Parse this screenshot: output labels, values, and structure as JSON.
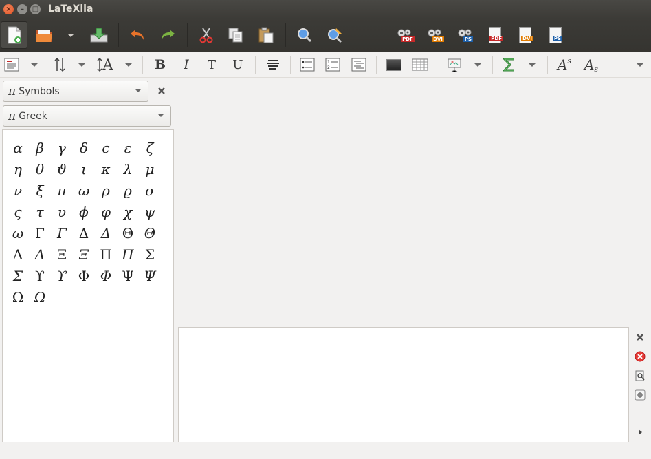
{
  "window": {
    "title": "LaTeXila"
  },
  "colors": {
    "pdf": "#c62828",
    "dvi": "#e07b00",
    "ps": "#1d5fa8",
    "undo": "#e8732a",
    "redo": "#7cb342"
  },
  "toolbar": {
    "new": "new-document-icon",
    "open": "open-folder-icon",
    "save": "save-icon",
    "undo": "undo-icon",
    "redo": "redo-icon",
    "cut": "cut-icon",
    "copy": "copy-icon",
    "paste": "paste-icon",
    "find": "find-icon",
    "replace": "find-replace-icon",
    "build_pdf": "PDF",
    "build_dvi": "DVI",
    "build_ps": "PS",
    "view_pdf": "PDF",
    "view_dvi": "DVI",
    "view_ps": "PS"
  },
  "format": {
    "bold": "B",
    "italic": "I",
    "typewriter": "T",
    "underline": "U",
    "size": "A",
    "superscript_base": "A",
    "superscript_exp": "s",
    "subscript_base": "A",
    "subscript_exp": "s"
  },
  "sidepanel": {
    "category_symbol": "π",
    "category": "Symbols",
    "subcategory_symbol": "π",
    "subcategory": "Greek",
    "symbols": [
      {
        "c": "α",
        "i": true
      },
      {
        "c": "β",
        "i": true
      },
      {
        "c": "γ",
        "i": true
      },
      {
        "c": "δ",
        "i": true
      },
      {
        "c": "ϵ",
        "i": true
      },
      {
        "c": "ε",
        "i": true
      },
      {
        "c": "ζ",
        "i": true
      },
      {
        "c": "η",
        "i": true
      },
      {
        "c": "θ",
        "i": true
      },
      {
        "c": "ϑ",
        "i": true
      },
      {
        "c": "ι",
        "i": true
      },
      {
        "c": "κ",
        "i": true
      },
      {
        "c": "λ",
        "i": true
      },
      {
        "c": "μ",
        "i": true
      },
      {
        "c": "ν",
        "i": true
      },
      {
        "c": "ξ",
        "i": true
      },
      {
        "c": "π",
        "i": true
      },
      {
        "c": "ϖ",
        "i": true
      },
      {
        "c": "ρ",
        "i": true
      },
      {
        "c": "ϱ",
        "i": true
      },
      {
        "c": "σ",
        "i": true
      },
      {
        "c": "ς",
        "i": true
      },
      {
        "c": "τ",
        "i": true
      },
      {
        "c": "υ",
        "i": true
      },
      {
        "c": "ϕ",
        "i": true
      },
      {
        "c": "φ",
        "i": true
      },
      {
        "c": "χ",
        "i": true
      },
      {
        "c": "ψ",
        "i": true
      },
      {
        "c": "ω",
        "i": true
      },
      {
        "c": "Γ",
        "i": false
      },
      {
        "c": "Γ",
        "i": true
      },
      {
        "c": "Δ",
        "i": false
      },
      {
        "c": "Δ",
        "i": true
      },
      {
        "c": "Θ",
        "i": false
      },
      {
        "c": "Θ",
        "i": true
      },
      {
        "c": "Λ",
        "i": false
      },
      {
        "c": "Λ",
        "i": true
      },
      {
        "c": "Ξ",
        "i": false
      },
      {
        "c": "Ξ",
        "i": true
      },
      {
        "c": "Π",
        "i": false
      },
      {
        "c": "Π",
        "i": true
      },
      {
        "c": "Σ",
        "i": false
      },
      {
        "c": "Σ",
        "i": true
      },
      {
        "c": "ϒ",
        "i": false
      },
      {
        "c": "ϒ",
        "i": true
      },
      {
        "c": "Φ",
        "i": false
      },
      {
        "c": "Φ",
        "i": true
      },
      {
        "c": "Ψ",
        "i": false
      },
      {
        "c": "Ψ",
        "i": true
      },
      {
        "c": "Ω",
        "i": false
      },
      {
        "c": "Ω",
        "i": true
      }
    ]
  }
}
